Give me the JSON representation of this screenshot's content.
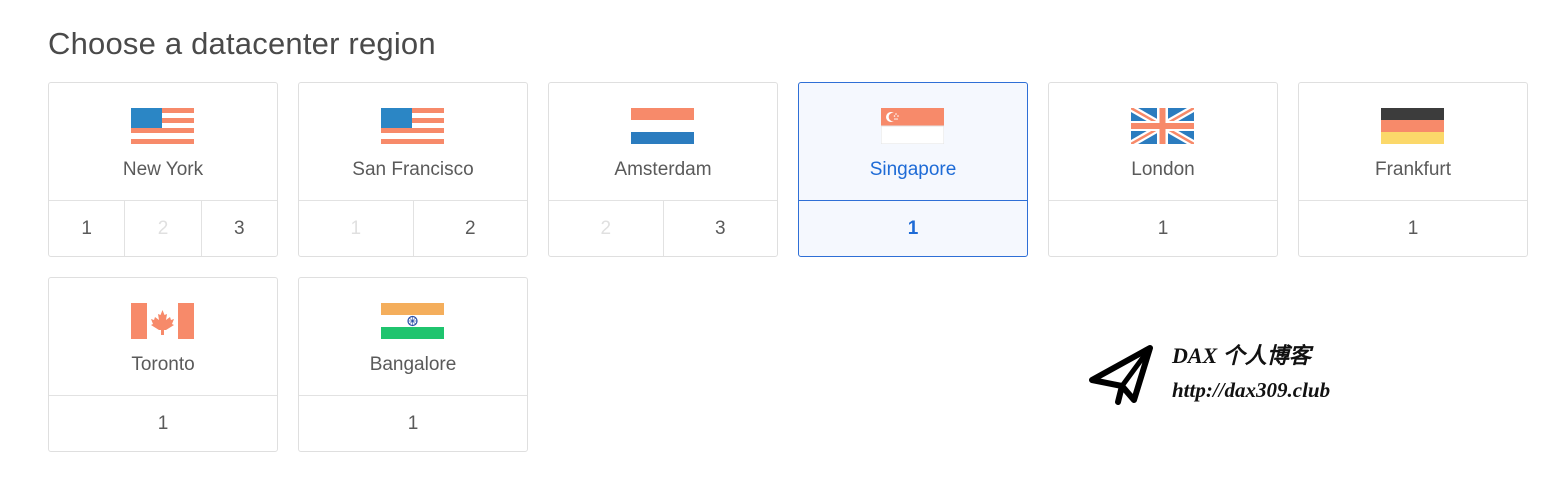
{
  "page": {
    "title": "Choose a datacenter region"
  },
  "regions": [
    {
      "name": "New York",
      "flag": "us-flag-icon",
      "selected": false,
      "slots": [
        {
          "label": "1",
          "enabled": true
        },
        {
          "label": "2",
          "enabled": false
        },
        {
          "label": "3",
          "enabled": true
        }
      ]
    },
    {
      "name": "San Francisco",
      "flag": "us-flag-icon",
      "selected": false,
      "slots": [
        {
          "label": "1",
          "enabled": false
        },
        {
          "label": "2",
          "enabled": true
        }
      ]
    },
    {
      "name": "Amsterdam",
      "flag": "netherlands-flag-icon",
      "selected": false,
      "slots": [
        {
          "label": "2",
          "enabled": false
        },
        {
          "label": "3",
          "enabled": true
        }
      ]
    },
    {
      "name": "Singapore",
      "flag": "singapore-flag-icon",
      "selected": true,
      "slots": [
        {
          "label": "1",
          "enabled": true
        }
      ]
    },
    {
      "name": "London",
      "flag": "uk-flag-icon",
      "selected": false,
      "slots": [
        {
          "label": "1",
          "enabled": true
        }
      ]
    },
    {
      "name": "Frankfurt",
      "flag": "germany-flag-icon",
      "selected": false,
      "slots": [
        {
          "label": "1",
          "enabled": true
        }
      ]
    },
    {
      "name": "Toronto",
      "flag": "canada-flag-icon",
      "selected": false,
      "slots": [
        {
          "label": "1",
          "enabled": true
        }
      ]
    },
    {
      "name": "Bangalore",
      "flag": "india-flag-icon",
      "selected": false,
      "slots": [
        {
          "label": "1",
          "enabled": true
        }
      ]
    }
  ],
  "watermark": {
    "line1": "DAX 个人博客",
    "line2": "http://dax309.club",
    "icon": "paper-plane-icon"
  },
  "colors": {
    "accent": "#1e6bd6",
    "selected_bg": "#f5f8fe",
    "border": "#dfdfdf",
    "text": "#5a5a5a",
    "disabled_text": "#e0e0e0"
  }
}
